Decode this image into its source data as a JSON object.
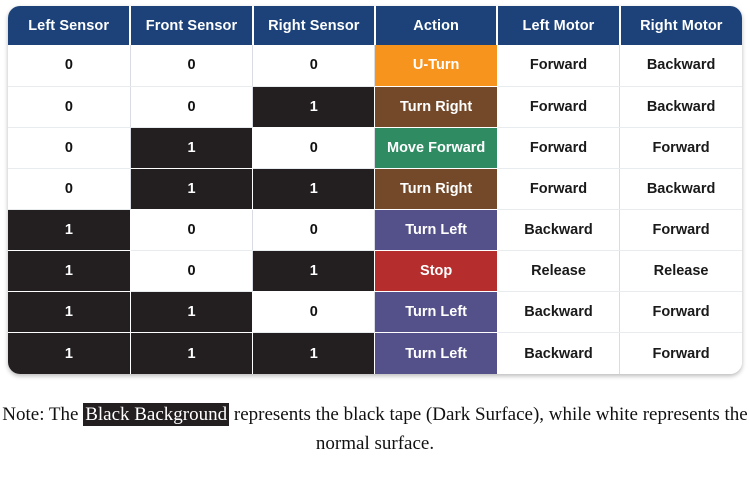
{
  "table": {
    "columns": [
      {
        "key": "left_sensor",
        "label": "Left Sensor"
      },
      {
        "key": "front_sensor",
        "label": "Front Sensor"
      },
      {
        "key": "right_sensor",
        "label": "Right Sensor"
      },
      {
        "key": "action",
        "label": "Action"
      },
      {
        "key": "left_motor",
        "label": "Left Motor"
      },
      {
        "key": "right_motor",
        "label": "Right Motor"
      }
    ],
    "header_background": "#1d4279",
    "header_text_color": "#ffffff",
    "dark_cell_background": "#231f20",
    "dark_cell_text_color": "#ffffff",
    "light_cell_background": "#ffffff",
    "light_cell_text_color": "#111111",
    "action_colors": {
      "U-Turn": "#f7941e",
      "Turn Right": "#73492a",
      "Move Forward": "#2e8b62",
      "Turn Left": "#53508a",
      "Stop": "#b52d2d"
    },
    "rows": [
      {
        "left_sensor": "0",
        "front_sensor": "0",
        "right_sensor": "0",
        "action": "U-Turn",
        "action_color": "#f7941e",
        "left_motor": "Forward",
        "right_motor": "Backward"
      },
      {
        "left_sensor": "0",
        "front_sensor": "0",
        "right_sensor": "1",
        "action": "Turn Right",
        "action_color": "#73492a",
        "left_motor": "Forward",
        "right_motor": "Backward"
      },
      {
        "left_sensor": "0",
        "front_sensor": "1",
        "right_sensor": "0",
        "action": "Move Forward",
        "action_color": "#2e8b62",
        "left_motor": "Forward",
        "right_motor": "Forward"
      },
      {
        "left_sensor": "0",
        "front_sensor": "1",
        "right_sensor": "1",
        "action": "Turn Right",
        "action_color": "#73492a",
        "left_motor": "Forward",
        "right_motor": "Backward"
      },
      {
        "left_sensor": "1",
        "front_sensor": "0",
        "right_sensor": "0",
        "action": "Turn Left",
        "action_color": "#53508a",
        "left_motor": "Backward",
        "right_motor": "Forward"
      },
      {
        "left_sensor": "1",
        "front_sensor": "0",
        "right_sensor": "1",
        "action": "Stop",
        "action_color": "#b52d2d",
        "left_motor": "Release",
        "right_motor": "Release"
      },
      {
        "left_sensor": "1",
        "front_sensor": "1",
        "right_sensor": "0",
        "action": "Turn Left",
        "action_color": "#53508a",
        "left_motor": "Backward",
        "right_motor": "Forward"
      },
      {
        "left_sensor": "1",
        "front_sensor": "1",
        "right_sensor": "1",
        "action": "Turn Left",
        "action_color": "#53508a",
        "left_motor": "Backward",
        "right_motor": "Forward"
      }
    ]
  },
  "note": {
    "prefix": "Note: The ",
    "highlight": "Black Background",
    "suffix": " represents the black tape (Dark Surface), while white represents the normal surface."
  }
}
